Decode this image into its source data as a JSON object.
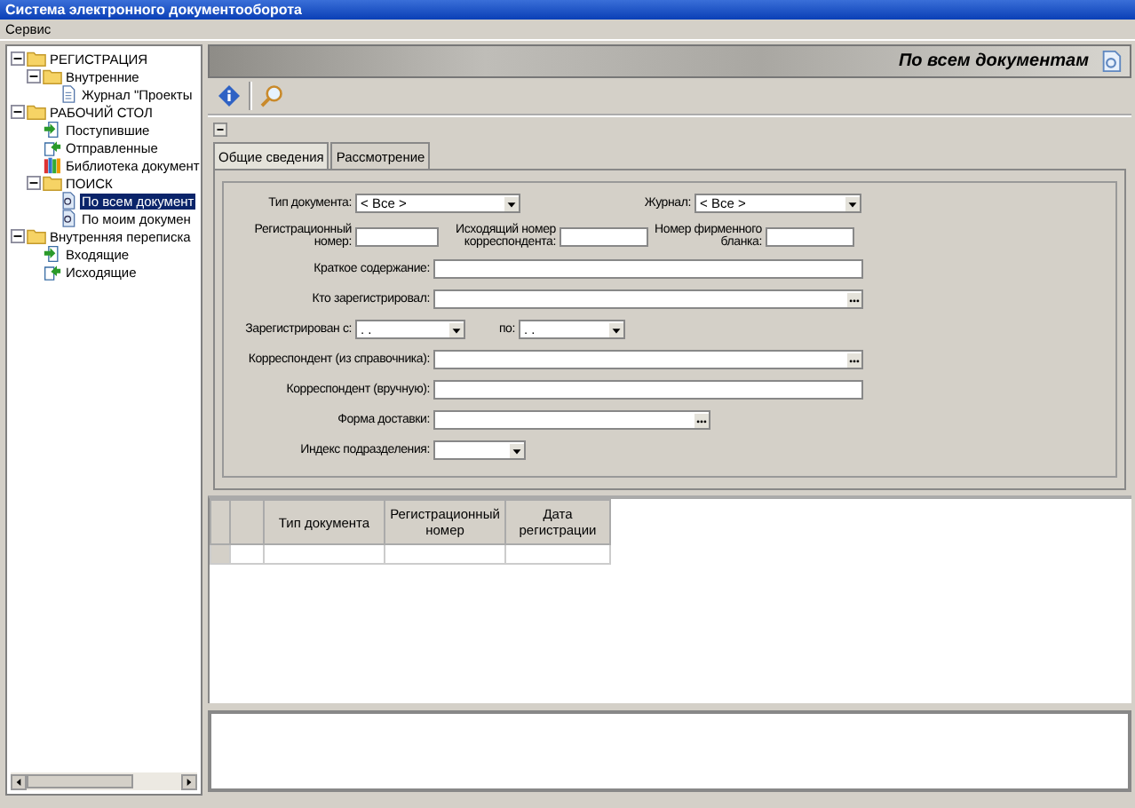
{
  "window": {
    "title": "Система электронного документооборота"
  },
  "menu": [
    "Сервис"
  ],
  "tree": [
    {
      "label": "РЕГИСТРАЦИЯ",
      "kind": "folder",
      "expanded": true,
      "selected": false,
      "children": [
        {
          "label": "Внутренние",
          "kind": "folder",
          "expanded": true,
          "selected": false,
          "children": [
            {
              "label": "Журнал \"Проекты",
              "kind": "doc",
              "selected": false
            }
          ]
        }
      ]
    },
    {
      "label": "РАБОЧИЙ СТОЛ",
      "kind": "folder",
      "expanded": true,
      "selected": false,
      "children": [
        {
          "label": "Поступившие",
          "kind": "incoming",
          "selected": false
        },
        {
          "label": "Отправленные",
          "kind": "outgoing",
          "selected": false
        },
        {
          "label": "Библиотека документ",
          "kind": "library",
          "selected": false
        },
        {
          "label": "ПОИСК",
          "kind": "folder",
          "expanded": true,
          "selected": false,
          "children": [
            {
              "label": "По всем документ",
              "kind": "search-doc",
              "selected": true
            },
            {
              "label": "По моим докумен",
              "kind": "search-doc",
              "selected": false
            }
          ]
        }
      ]
    },
    {
      "label": "Внутренняя переписка",
      "kind": "folder",
      "expanded": true,
      "selected": false,
      "children": [
        {
          "label": "Входящие",
          "kind": "incoming",
          "selected": false
        },
        {
          "label": "Исходящие",
          "kind": "outgoing",
          "selected": false
        }
      ]
    }
  ],
  "header": {
    "title": "По всем документам"
  },
  "tabs": [
    {
      "label": "Общие сведения",
      "selected": true
    },
    {
      "label": "Рассмотрение",
      "selected": false
    }
  ],
  "form": [
    [
      {
        "label": "Тип документа:",
        "kind": "combo",
        "value": "< Все >"
      },
      {
        "label": "Журнал:",
        "kind": "combo",
        "value": "< Все >"
      }
    ],
    [
      {
        "label": "Регистрационный номер:",
        "kind": "text"
      },
      {
        "label": "Исходящий номер корреспондента:",
        "kind": "text"
      },
      {
        "label": "Номер фирменного бланка:",
        "kind": "text"
      }
    ],
    [
      {
        "label": "Краткое содержание:",
        "kind": "text"
      }
    ],
    [
      {
        "label": "Кто зарегистрировал:",
        "kind": "lookup"
      }
    ],
    [
      {
        "label": "Зарегистрирован с:",
        "kind": "combo",
        "value": ". ."
      },
      {
        "label": "по:",
        "kind": "combo",
        "value": ". ."
      }
    ],
    [
      {
        "label": "Корреспондент (из справочника):",
        "kind": "lookup"
      }
    ],
    [
      {
        "label": "Корреспондент (вручную):",
        "kind": "text"
      }
    ],
    [
      {
        "label": "Форма доставки:",
        "kind": "lookup"
      }
    ],
    [
      {
        "label": "Индекс подразделения:",
        "kind": "combo"
      }
    ]
  ],
  "grid": {
    "columns": [
      "Тип документа",
      "Регистрационный номер",
      "Дата регистрации"
    ]
  }
}
